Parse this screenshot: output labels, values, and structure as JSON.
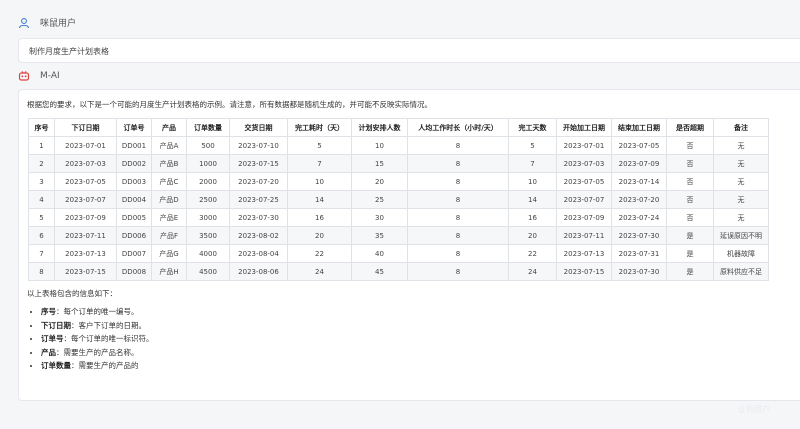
{
  "user": {
    "name": "咪鼠用户",
    "icon": "user-icon"
  },
  "prompt": {
    "text": "制作月度生产计划表格"
  },
  "assistant": {
    "name": "M-AI",
    "icon": "robot-icon",
    "accent": "#e0403c"
  },
  "answer": {
    "intro": "根据您的要求，以下是一个可能的月度生产计划表格的示例。请注意，所有数据都是随机生成的，并可能不反映实际情况。",
    "table": {
      "headers": [
        "序号",
        "下订日期",
        "订单号",
        "产品",
        "订单数量",
        "交货日期",
        "完工耗时（天）",
        "计划安排人数",
        "人均工作时长（小时/天）",
        "完工天数",
        "开始加工日期",
        "结束加工日期",
        "是否超期",
        "备注"
      ],
      "rows": [
        [
          "1",
          "2023-07-01",
          "DD001",
          "产品A",
          "500",
          "2023-07-10",
          "5",
          "10",
          "8",
          "5",
          "2023-07-01",
          "2023-07-05",
          "否",
          "无"
        ],
        [
          "2",
          "2023-07-03",
          "DD002",
          "产品B",
          "1000",
          "2023-07-15",
          "7",
          "15",
          "8",
          "7",
          "2023-07-03",
          "2023-07-09",
          "否",
          "无"
        ],
        [
          "3",
          "2023-07-05",
          "DD003",
          "产品C",
          "2000",
          "2023-07-20",
          "10",
          "20",
          "8",
          "10",
          "2023-07-05",
          "2023-07-14",
          "否",
          "无"
        ],
        [
          "4",
          "2023-07-07",
          "DD004",
          "产品D",
          "2500",
          "2023-07-25",
          "14",
          "25",
          "8",
          "14",
          "2023-07-07",
          "2023-07-20",
          "否",
          "无"
        ],
        [
          "5",
          "2023-07-09",
          "DD005",
          "产品E",
          "3000",
          "2023-07-30",
          "16",
          "30",
          "8",
          "16",
          "2023-07-09",
          "2023-07-24",
          "否",
          "无"
        ],
        [
          "6",
          "2023-07-11",
          "DD006",
          "产品F",
          "3500",
          "2023-08-02",
          "20",
          "35",
          "8",
          "20",
          "2023-07-11",
          "2023-07-30",
          "是",
          "延误原因不明"
        ],
        [
          "7",
          "2023-07-13",
          "DD007",
          "产品G",
          "4000",
          "2023-08-04",
          "22",
          "40",
          "8",
          "22",
          "2023-07-13",
          "2023-07-31",
          "是",
          "机器故障"
        ],
        [
          "8",
          "2023-07-15",
          "DD008",
          "产品H",
          "4500",
          "2023-08-06",
          "24",
          "45",
          "8",
          "24",
          "2023-07-15",
          "2023-07-30",
          "是",
          "原料供应不足"
        ]
      ]
    },
    "summary": "以上表格包含的信息如下：",
    "fields": [
      {
        "term": "序号",
        "desc": "：每个订单的唯一编号。"
      },
      {
        "term": "下订日期",
        "desc": "：客户下订单的日期。"
      },
      {
        "term": "订单号",
        "desc": "：每个订单的唯一标识符。"
      },
      {
        "term": "产品",
        "desc": "：需要生产的产品名称。"
      },
      {
        "term": "订单数量",
        "desc": "：需要生产的产品的"
      }
    ]
  },
  "watermark": "让利用户"
}
